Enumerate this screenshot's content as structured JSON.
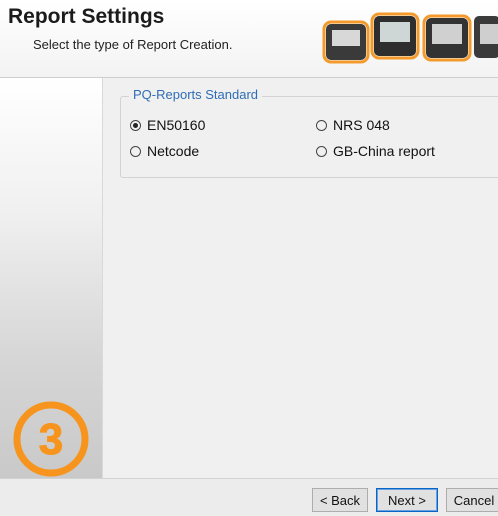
{
  "header": {
    "title": "Report Settings",
    "subtitle": "Select the type of Report Creation."
  },
  "sidebar": {
    "step_number": "3",
    "step_color": "#f7941d"
  },
  "group": {
    "legend": "PQ-Reports Standard",
    "legend_color": "#2f6db5",
    "options": [
      {
        "label": "EN50160",
        "checked": true
      },
      {
        "label": "NRS 048",
        "checked": false
      },
      {
        "label": "Netcode",
        "checked": false
      },
      {
        "label": "GB-China report",
        "checked": false
      }
    ]
  },
  "footer": {
    "back_label": "< Back",
    "next_label": "Next >",
    "cancel_label": "Cancel"
  }
}
